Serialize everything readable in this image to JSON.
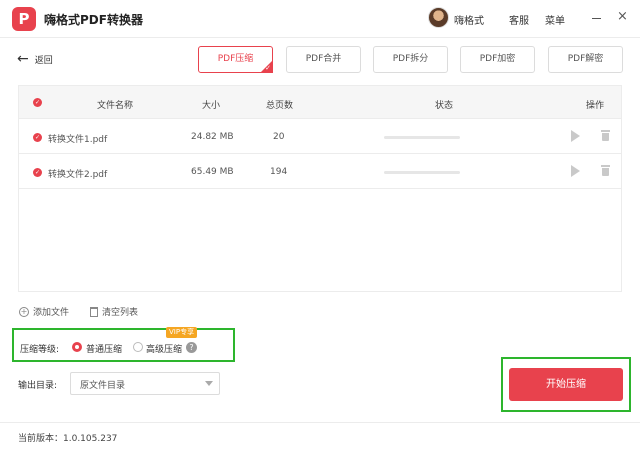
{
  "app": {
    "logo_letter": "P",
    "title": "嗨格式PDF转换器",
    "username": "嗨格式",
    "service": "客服",
    "menu": "菜单",
    "close_glyph": "×"
  },
  "nav": {
    "back_label": "返回",
    "back_glyph": "←"
  },
  "tabs": [
    {
      "label": "PDF压缩",
      "active": true
    },
    {
      "label": "PDF合并",
      "active": false
    },
    {
      "label": "PDF拆分",
      "active": false
    },
    {
      "label": "PDF加密",
      "active": false
    },
    {
      "label": "PDF解密",
      "active": false
    }
  ],
  "table": {
    "headers": {
      "name": "文件名称",
      "size": "大小",
      "pages": "总页数",
      "status": "状态",
      "action": "操作"
    },
    "rows": [
      {
        "name": "转换文件1.pdf",
        "size": "24.82 MB",
        "pages": "20",
        "progress": 0
      },
      {
        "name": "转换文件2.pdf",
        "size": "65.49 MB",
        "pages": "194",
        "progress": 0
      }
    ]
  },
  "tools": {
    "add_file": "添加文件",
    "clear_list": "清空列表"
  },
  "compression": {
    "label": "压缩等级:",
    "options": [
      "普通压缩",
      "高级压缩"
    ],
    "selected": "普通压缩",
    "vip_badge": "VIP专享",
    "help_glyph": "?"
  },
  "output": {
    "label": "输出目录:",
    "value": "原文件目录"
  },
  "start_button": "开始压缩",
  "footer": {
    "version": "当前版本：1.0.105.237"
  },
  "colors": {
    "accent": "#e8424d",
    "highlight_frame": "#2db52d",
    "vip": "#f5a623"
  },
  "icons": [
    "app-logo",
    "avatar",
    "minimize-icon",
    "close-icon",
    "back-arrow-icon",
    "check-icon",
    "play-icon",
    "trash-icon",
    "add-icon",
    "clear-icon",
    "help-icon",
    "dropdown-caret-icon"
  ]
}
